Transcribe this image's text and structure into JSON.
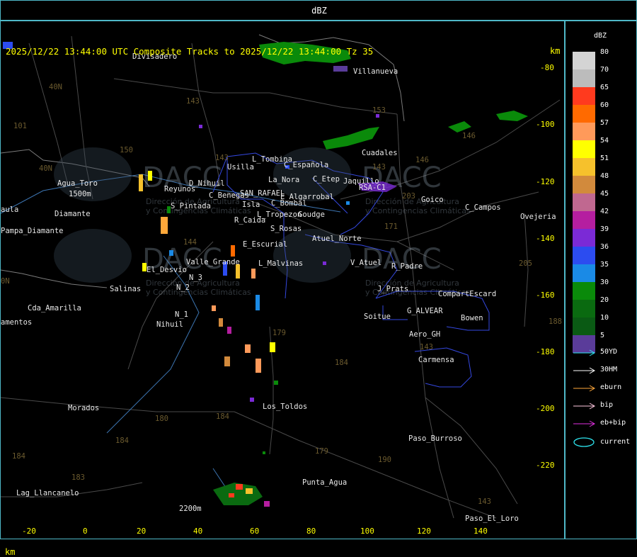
{
  "window": {
    "title": "dBZ"
  },
  "header": {
    "line": "2025/12/22 13:44:00 UTC Composite Tracks to 2025/12/22 13:44:00 Tz 35",
    "km_top": "km",
    "km_bottom": "km"
  },
  "axes": {
    "y_ticks": [
      "-80",
      "-100",
      "-120",
      "-140",
      "-160",
      "-180",
      "-200",
      "-220"
    ],
    "x_ticks": [
      "-20",
      "0",
      "20",
      "40",
      "60",
      "80",
      "100",
      "120",
      "140"
    ]
  },
  "places": {
    "divisadero": "Divisadero",
    "villanueva": "Villanueva",
    "cuadales": "Cuadales",
    "tombina": "L_Tombina",
    "usilla": "Usilla",
    "la_nora": "La_Nora",
    "c_espanola": "C_Española",
    "c_etep": "C_Etep",
    "jaquillo": "Jaquillo",
    "rsa_c1": "RSA-C1",
    "goico": "Goico",
    "c_campos": "C_Campos",
    "ovejeria": "Ovejeria",
    "agua_toro": "Agua_Toro",
    "s_pintada": "S_Pintada",
    "reyunos": "Reyunos",
    "el_nihuil_dam": "D_Nihuil",
    "c_benegas": "C_Benegas",
    "san_rafael": "SAN_RAFAEL",
    "el_algarrobal": "E_Algarrobal",
    "c_bombal": "C_Bombal",
    "isla": "Isla",
    "pampa_diamante": "Pampa_Diamante",
    "aula": "aula",
    "diamante": "Diamante",
    "r_caida": "R_Caida",
    "tropezon": "L_Tropezon",
    "goudge": "Goudge",
    "s_rosas": "S_Rosas",
    "atuel_norte": "Atuel_Norte",
    "e_escurial": "E_Escurial",
    "valle_grande": "Valle_Grande",
    "l_malvinas": "L_Malvinas",
    "v_atuel": "V_Atuel",
    "r_padre": "R_Padre",
    "el_desvio": "El_Desvio",
    "n3": "N_3",
    "n2": "N_2",
    "salinas": "Salinas",
    "j_prats": "J_Prats",
    "compart_escard": "CompartEscard",
    "cda_amarilla": "Cda_Amarilla",
    "n1": "N_1",
    "g_alvear": "G_ALVEAR",
    "bowen": "Bowen",
    "soitue": "Soitue",
    "nihuil": "Nihuil",
    "aero_gh": "Aero_GH",
    "carmensa": "Carmensa",
    "lamentos": "amentos",
    "los_toldos": "Los_Toldos",
    "morados": "Morados",
    "paso_burroso": "Paso_Burroso",
    "punta_agua": "Punta_Agua",
    "lag_llancanelo": "Lag_Llancanelo",
    "paso_el_loro": "Paso_El_Loro",
    "elev_1500": "1500m",
    "elev_2200": "2200m"
  },
  "routes": {
    "r40n_a": "40N",
    "r40n_b": "40N",
    "r101": "101",
    "r143": "143",
    "r150": "150",
    "r153": "153",
    "r146a": "146",
    "r146b": "146",
    "r203": "203",
    "r171": "171",
    "r144": "144",
    "r179a": "179",
    "r184a": "184",
    "r180": "180",
    "r184b": "184",
    "r184c": "184",
    "r183": "183",
    "r179b": "179",
    "r190": "190",
    "r143b": "143",
    "r143c": "143",
    "r205": "205",
    "r188": "188",
    "r143d": "143",
    "r0n": "0N"
  },
  "watermark": {
    "logo": "DACC",
    "line1": "Dirección de Agricultura",
    "line2": "y Contingencias Climáticas"
  },
  "legend": {
    "title": "dBZ",
    "levels": [
      {
        "value": "80",
        "color": "#d4d4d4"
      },
      {
        "value": "70",
        "color": "#bcbcbc"
      },
      {
        "value": "65",
        "color": "#ff3a1e"
      },
      {
        "value": "60",
        "color": "#ff6a00"
      },
      {
        "value": "57",
        "color": "#ff9a5a"
      },
      {
        "value": "54",
        "color": "#ffff00"
      },
      {
        "value": "51",
        "color": "#f6c12c"
      },
      {
        "value": "48",
        "color": "#d28a3c"
      },
      {
        "value": "45",
        "color": "#c06890"
      },
      {
        "value": "42",
        "color": "#b51ea0"
      },
      {
        "value": "39",
        "color": "#7b2ad6"
      },
      {
        "value": "36",
        "color": "#2c4cf0"
      },
      {
        "value": "35",
        "color": "#1a8ae6"
      },
      {
        "value": "30",
        "color": "#0a8a0a"
      },
      {
        "value": "20",
        "color": "#0a6a10"
      },
      {
        "value": "10",
        "color": "#0a5a14"
      },
      {
        "value": "5",
        "color": "#5a3c9a"
      }
    ],
    "tracks": [
      {
        "label": "50YD",
        "color": "#2ee6f0"
      },
      {
        "label": "30HM",
        "color": "#ffffff"
      },
      {
        "label": "eburn",
        "color": "#ffa83a"
      },
      {
        "label": "bip",
        "color": "#ffc8e0"
      },
      {
        "label": "eb+bip",
        "color": "#e030e0"
      }
    ],
    "current_label": "current"
  }
}
